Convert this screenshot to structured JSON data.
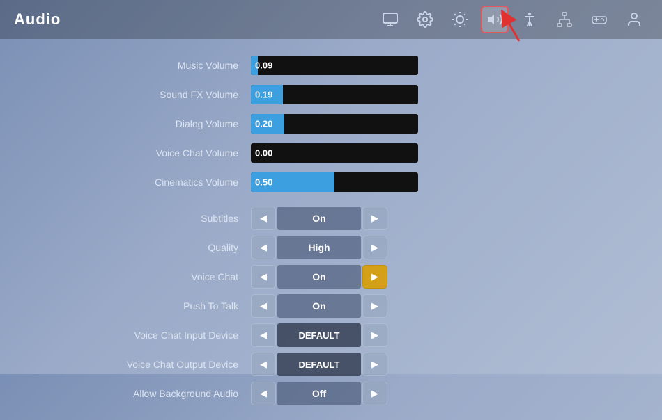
{
  "header": {
    "title": "Audio",
    "nav": [
      {
        "id": "monitor",
        "icon": "monitor",
        "active": false
      },
      {
        "id": "settings",
        "icon": "gear",
        "active": false
      },
      {
        "id": "brightness",
        "icon": "brightness",
        "active": false
      },
      {
        "id": "audio",
        "icon": "speaker",
        "active": true
      },
      {
        "id": "accessibility",
        "icon": "person-circle",
        "active": false
      },
      {
        "id": "network",
        "icon": "network",
        "active": false
      },
      {
        "id": "controller",
        "icon": "controller",
        "active": false
      },
      {
        "id": "account",
        "icon": "account",
        "active": false
      }
    ]
  },
  "sliders": [
    {
      "label": "Music Volume",
      "value": "0.09",
      "percent": 4
    },
    {
      "label": "Sound FX Volume",
      "value": "0.19",
      "percent": 19
    },
    {
      "label": "Dialog Volume",
      "value": "0.20",
      "percent": 20
    },
    {
      "label": "Voice Chat Volume",
      "value": "0.00",
      "percent": 0
    },
    {
      "label": "Cinematics Volume",
      "value": "0.50",
      "percent": 50
    }
  ],
  "toggles": [
    {
      "label": "Subtitles",
      "value": "On",
      "right_yellow": false
    },
    {
      "label": "Quality",
      "value": "High",
      "right_yellow": false
    },
    {
      "label": "Voice Chat",
      "value": "On",
      "right_yellow": true
    },
    {
      "label": "Push To Talk",
      "value": "On",
      "right_yellow": false
    },
    {
      "label": "Voice Chat Input Device",
      "value": "DEFAULT",
      "dark": true,
      "right_yellow": false
    },
    {
      "label": "Voice Chat Output Device",
      "value": "DEFAULT",
      "dark": true,
      "right_yellow": false
    },
    {
      "label": "Allow Background Audio",
      "value": "Off",
      "dark": false,
      "right_yellow": false
    }
  ],
  "arrow": {
    "color": "#e03030"
  }
}
